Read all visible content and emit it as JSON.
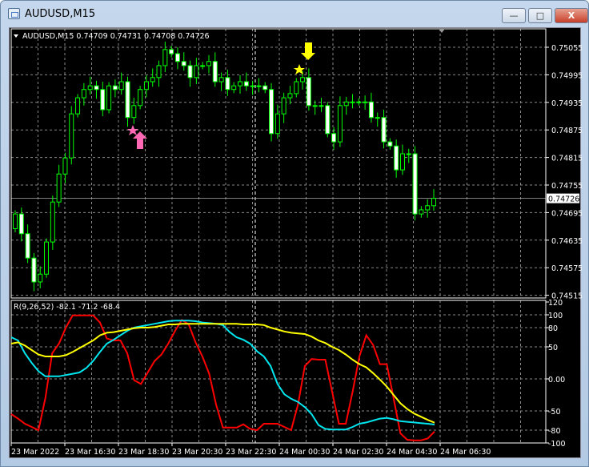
{
  "window": {
    "title": "AUDUSD,M15",
    "buttons": [
      "minimize",
      "maximize",
      "close"
    ]
  },
  "chart": {
    "symbol_label": "AUDUSD,M15  0.74709 0.74731 0.74708 0.74726",
    "current_price": "0.74726",
    "price_ticks": [
      "0.75055",
      "0.74995",
      "0.74935",
      "0.74875",
      "0.74815",
      "0.74755",
      "0.74695",
      "0.74635",
      "0.74575",
      "0.74515"
    ],
    "time_labels": [
      "23 Mar 2022",
      "23 Mar 16:30",
      "23 Mar 18:30",
      "23 Mar 20:30",
      "23 Mar 22:30",
      "24 Mar 00:30",
      "24 Mar 02:30",
      "24 Mar 04:30",
      "24 Mar 06:30"
    ],
    "colors": {
      "background": "#000000",
      "candle_outline": "#00ff00",
      "bear_fill": "#ffffff",
      "bull_fill": "#000000",
      "grid": "#8a8a8a",
      "buy_arrow": "#ff69b4",
      "sell_arrow": "#ffff00"
    },
    "signals": [
      {
        "type": "buy",
        "icon": "up-arrow-icon",
        "color": "#ff69b4"
      },
      {
        "type": "sell",
        "icon": "down-arrow-icon",
        "color": "#ffff00"
      }
    ]
  },
  "indicator": {
    "label": "R(9,26,52) -82.1 -71.2 -68.4",
    "ticks": [
      "120",
      "100",
      "80",
      "50",
      "0.00",
      "-50",
      "-80",
      "-100"
    ]
  },
  "chart_data": [
    {
      "type": "candlestick",
      "open_first": 0.7466,
      "closes": [
        0.74692,
        0.74649,
        0.74596,
        0.74544,
        0.74561,
        0.74631,
        0.74718,
        0.74779,
        0.74814,
        0.7491,
        0.74945,
        0.74963,
        0.74971,
        0.74963,
        0.74919,
        0.74971,
        0.74963,
        0.7498,
        0.74902,
        0.74928,
        0.74963,
        0.7498,
        0.74989,
        0.75015,
        0.7505,
        0.75041,
        0.75024,
        0.75015,
        0.74989,
        0.75015,
        0.75015,
        0.75024,
        0.7498,
        0.74989,
        0.74963,
        0.74971,
        0.7498,
        0.74971,
        0.74971,
        0.74971,
        0.74963,
        0.74867,
        0.7491,
        0.74945,
        0.74954,
        0.7498,
        0.74989,
        0.74928,
        0.74928,
        0.74928,
        0.74867,
        0.74849,
        0.74928,
        0.74936,
        0.74936,
        0.74936,
        0.74936,
        0.74902,
        0.74902,
        0.74849,
        0.7484,
        0.74788,
        0.74823,
        0.74823,
        0.74692,
        0.74701,
        0.7471,
        0.74726
      ],
      "ylim": [
        0.74505,
        0.7509
      ]
    },
    {
      "type": "line",
      "ylim": [
        -110,
        125
      ],
      "series": [
        {
          "color": "#ff0000",
          "values": [
            -55,
            -62,
            -70,
            -75,
            -80,
            -30,
            40,
            55,
            80,
            99,
            99,
            99,
            99,
            88,
            63,
            60,
            60,
            40,
            -2,
            -8,
            10,
            28,
            38,
            55,
            75,
            92,
            85,
            57,
            35,
            8,
            -40,
            -76,
            -76,
            -76,
            -71,
            -78,
            -80,
            -70,
            -70,
            -70,
            -75,
            -80,
            -40,
            20,
            31,
            30,
            30,
            -20,
            -70,
            -70,
            -20,
            35,
            68,
            53,
            23,
            23,
            -30,
            -85,
            -95,
            -96,
            -96,
            -93,
            -82.1
          ]
        },
        {
          "color": "#00e5ee",
          "values": [
            65,
            60,
            40,
            25,
            12,
            4,
            4,
            4,
            6,
            8,
            10,
            17,
            28,
            42,
            55,
            61,
            68,
            75,
            80,
            82,
            84,
            86,
            88,
            90,
            91,
            91,
            91,
            90,
            88,
            87,
            86,
            84,
            73,
            65,
            61,
            55,
            43,
            35,
            20,
            -8,
            -24,
            -31,
            -36,
            -44,
            -55,
            -72,
            -78,
            -79,
            -79,
            -79,
            -75,
            -70,
            -68,
            -65,
            -62,
            -61,
            -63,
            -66,
            -67,
            -68,
            -69,
            -70,
            -71.2
          ]
        },
        {
          "color": "#ffff00",
          "values": [
            55,
            57,
            52,
            45,
            38,
            35,
            35,
            35,
            37,
            42,
            48,
            54,
            60,
            68,
            72,
            73,
            75,
            77,
            79,
            80,
            80,
            81,
            83,
            85,
            85,
            86,
            86,
            86,
            86,
            86,
            86,
            86,
            86,
            86,
            85,
            85,
            85,
            84,
            80,
            77,
            74,
            72,
            71,
            70,
            66,
            60,
            56,
            50,
            45,
            38,
            30,
            23,
            18,
            9,
            -1,
            -12,
            -25,
            -38,
            -47,
            -54,
            -59,
            -64,
            -68.4
          ]
        }
      ]
    }
  ]
}
